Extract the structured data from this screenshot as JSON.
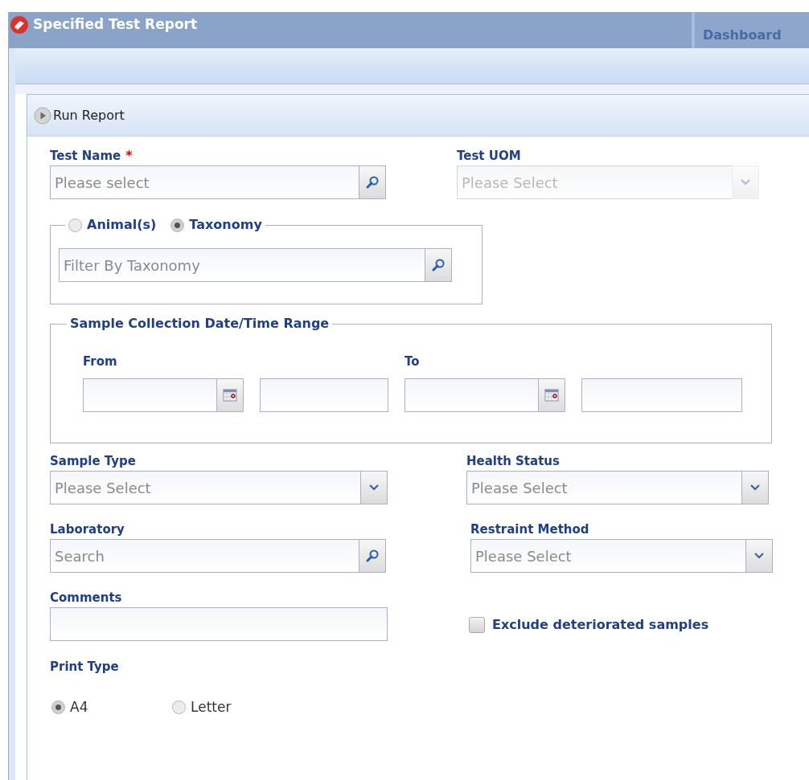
{
  "window": {
    "title": "Specified Test Report"
  },
  "background_tab": {
    "label": "Dashboard"
  },
  "toolbar": {
    "buttons": [
      {
        "label": "Run Report"
      }
    ]
  },
  "test_name": {
    "label": "Test Name",
    "required_mark": "*",
    "kind": "search",
    "placeholder": "Please select"
  },
  "test_uom": {
    "label": "Test UOM",
    "kind": "select",
    "placeholder": "Please Select",
    "disabled": true
  },
  "filter_group": {
    "options": [
      {
        "label": "Animal(s)",
        "selected": false
      },
      {
        "label": "Taxonomy",
        "selected": true
      }
    ],
    "field": {
      "kind": "search",
      "placeholder": "Filter By Taxonomy"
    }
  },
  "date_range": {
    "title": "Sample Collection Date/Time Range",
    "from": {
      "label": "From"
    },
    "to": {
      "label": "To"
    }
  },
  "sample_type": {
    "label": "Sample Type",
    "kind": "select",
    "placeholder": "Please Select"
  },
  "health_status": {
    "label": "Health Status",
    "kind": "select",
    "placeholder": "Please Select"
  },
  "laboratory": {
    "label": "Laboratory",
    "kind": "search",
    "placeholder": "Search"
  },
  "restraint_method": {
    "label": "Restraint Method",
    "kind": "select",
    "placeholder": "Please Select"
  },
  "comments": {
    "label": "Comments",
    "kind": "text"
  },
  "exclude_deteriorated": {
    "label": "Exclude deteriorated samples",
    "checked": false
  },
  "print_type": {
    "label": "Print Type",
    "options": [
      {
        "label": "A4",
        "selected": true
      },
      {
        "label": "Letter",
        "selected": false
      }
    ]
  }
}
